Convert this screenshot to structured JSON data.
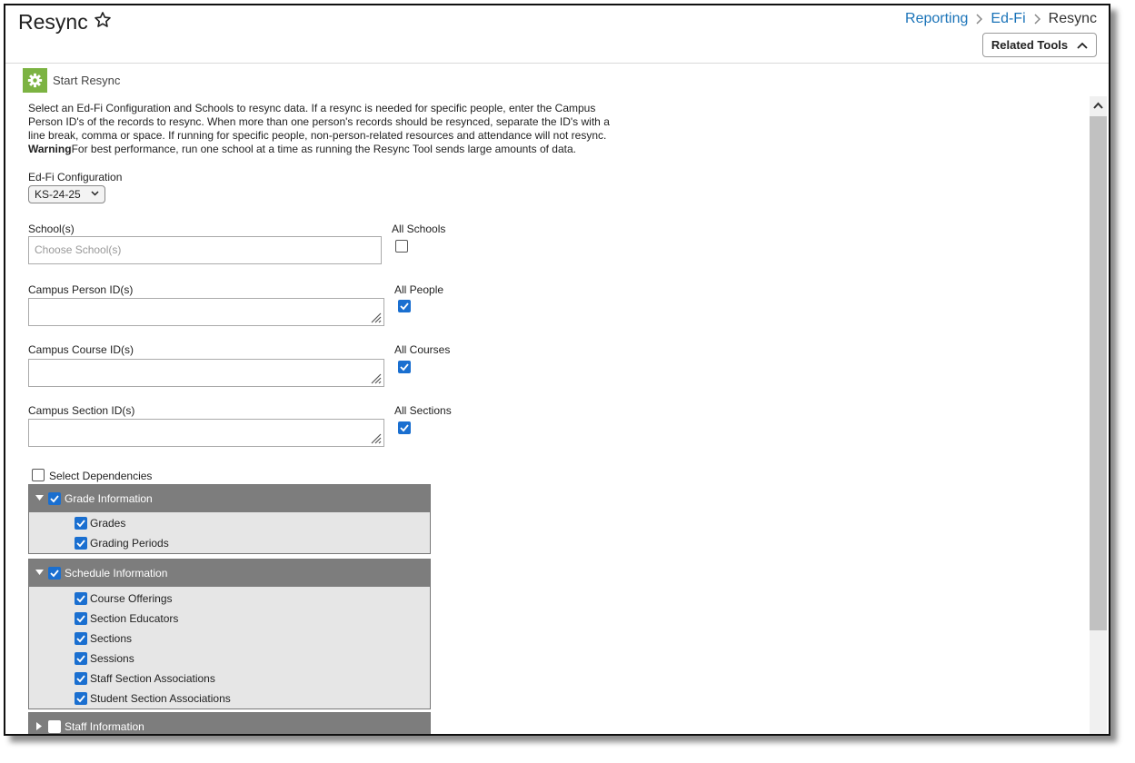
{
  "header": {
    "title": "Resync",
    "breadcrumb": {
      "item1": "Reporting",
      "item2": "Ed-Fi",
      "current": "Resync"
    },
    "related_tools": "Related Tools"
  },
  "section": {
    "label": "Start Resync"
  },
  "intro": {
    "line1": "Select an Ed-Fi Configuration and Schools to resync data. If a resync is needed for specific people, enter the Campus",
    "line2": "Person ID's of the records to resync. When more than one person's records should be resynced, separate the ID's with a",
    "line3": "line break, comma or space. If running for specific people, non-person-related resources and attendance will not resync.",
    "warning_label": "Warning",
    "warning_text": "For best performance, run one school at a time as running the Resync Tool sends large amounts of data."
  },
  "form": {
    "config_label": "Ed-Fi Configuration",
    "config_value": "KS-24-25",
    "schools_label": "School(s)",
    "schools_placeholder": "Choose School(s)",
    "all_schools_label": "All Schools",
    "all_schools_checked": false,
    "person_label": "Campus Person ID(s)",
    "all_people_label": "All People",
    "all_people_checked": true,
    "course_label": "Campus Course ID(s)",
    "all_courses_label": "All Courses",
    "all_courses_checked": true,
    "section_label": "Campus Section ID(s)",
    "all_sections_label": "All Sections",
    "all_sections_checked": true,
    "dependencies_label": "Select Dependencies",
    "dependencies_checked": false
  },
  "groups": [
    {
      "label": "Grade Information",
      "expanded": true,
      "checked": true,
      "items": [
        {
          "label": "Grades",
          "checked": true
        },
        {
          "label": "Grading Periods",
          "checked": true
        }
      ]
    },
    {
      "label": "Schedule Information",
      "expanded": true,
      "checked": true,
      "items": [
        {
          "label": "Course Offerings",
          "checked": true
        },
        {
          "label": "Section Educators",
          "checked": true
        },
        {
          "label": "Sections",
          "checked": true
        },
        {
          "label": "Sessions",
          "checked": true
        },
        {
          "label": "Staff Section Associations",
          "checked": true
        },
        {
          "label": "Student Section Associations",
          "checked": true
        }
      ]
    },
    {
      "label": "Staff Information",
      "expanded": false,
      "checked": false,
      "items": []
    }
  ],
  "colors": {
    "link": "#1a73b8",
    "checkbox": "#1a6fd0",
    "section_icon": "#7cb342",
    "group_header": "#7d7d7d",
    "group_body": "#e6e6e6"
  }
}
